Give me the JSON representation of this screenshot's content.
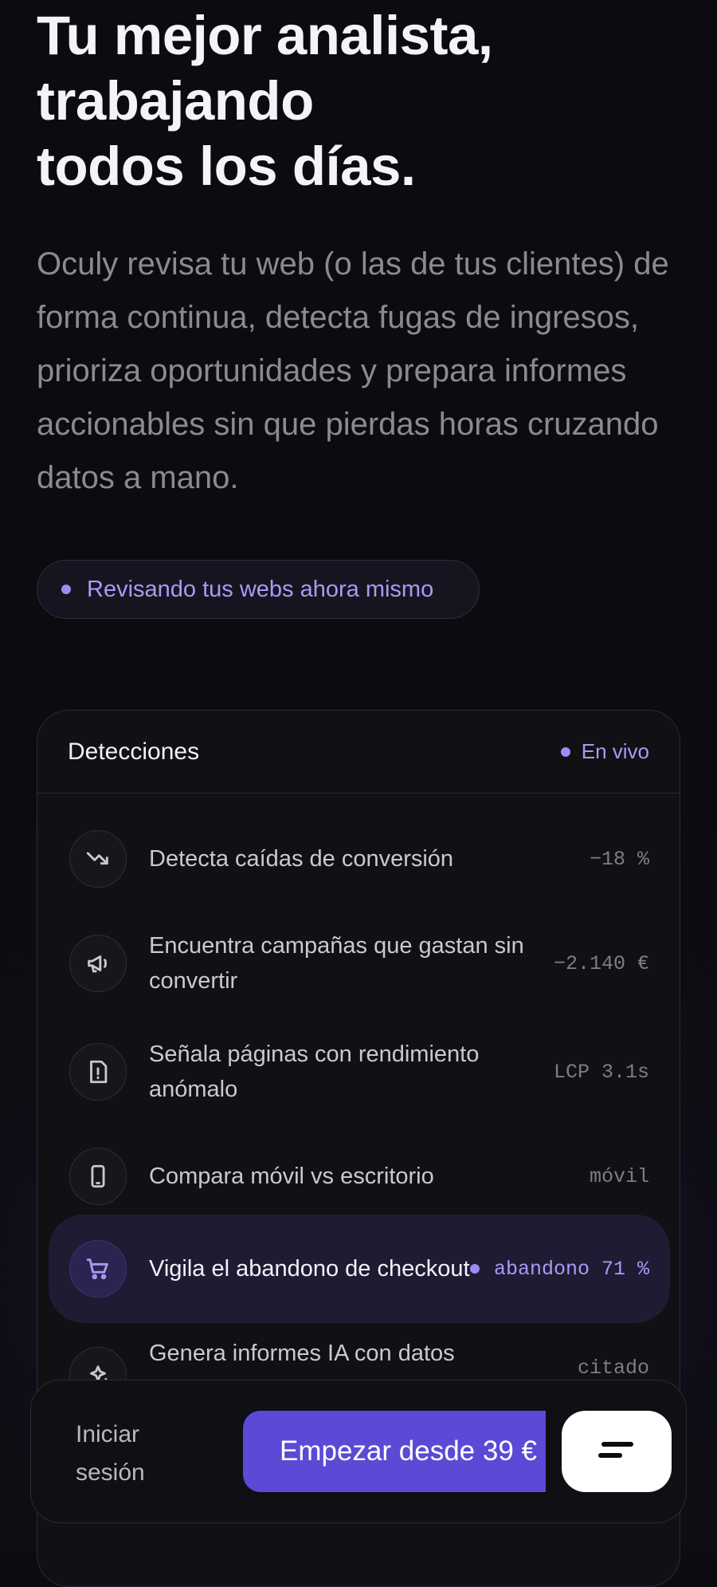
{
  "hero": {
    "title_line1": "Tu mejor analista,",
    "title_line2": "trabajando",
    "title_line3": "todos los días.",
    "description": "Oculy revisa tu web (o las de tus clientes) de forma continua, detecta fugas de ingresos, prioriza oportunidades y prepara informes accionables sin que pierdas horas cruzando datos a mano."
  },
  "status_pill": {
    "label": "Revisando tus webs ahora mismo"
  },
  "panel": {
    "title": "Detecciones",
    "live_label": "En vivo",
    "rows": [
      {
        "icon": "trending-down-icon",
        "label": "Detecta caídas de conversión",
        "value": "−18 %"
      },
      {
        "icon": "megaphone-icon",
        "label": "Encuentra campañas que gastan sin convertir",
        "value": "−2.140 €"
      },
      {
        "icon": "alert-document-icon",
        "label": "Señala páginas con rendimiento anómalo",
        "value": "LCP 3.1s"
      },
      {
        "icon": "smartphone-icon",
        "label": "Compara móvil vs escritorio",
        "value": "móvil"
      },
      {
        "icon": "cart-icon",
        "label": "Vigila el abandono de checkout",
        "value": "abandono 71 %"
      },
      {
        "icon": "sparkles-icon",
        "label": "Genera informes IA con datos",
        "value": "citado"
      }
    ]
  },
  "bottom_bar": {
    "login_label": "Iniciar sesión",
    "cta_label": "Empezar desde 39 €"
  },
  "colors": {
    "accent": "#5a4ad6",
    "accent_light": "#a99af7",
    "background": "#0b0b10"
  }
}
